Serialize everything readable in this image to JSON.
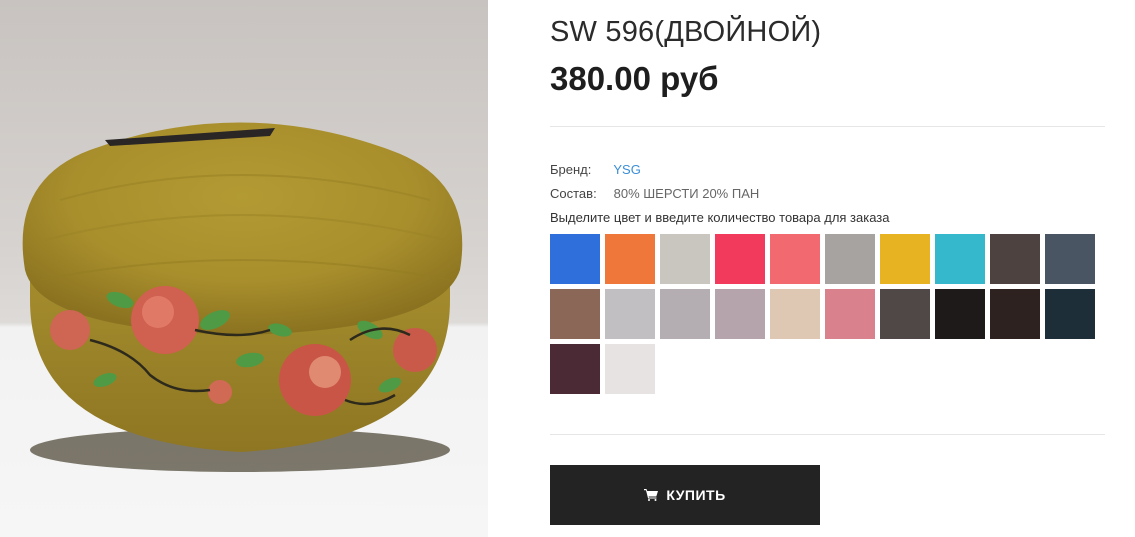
{
  "product": {
    "title": "SW 596(ДВОЙНОЙ)",
    "price": "380.00 руб"
  },
  "meta": {
    "brand_label": "Бренд:",
    "brand_value": "YSG",
    "composition_label": "Состав:",
    "composition_value": "80% ШЕРСТИ 20% ПАН"
  },
  "instruction": "Выделите цвет и введите количество товара для заказа",
  "colors": {
    "swatches": [
      "#2f6fdb",
      "#f0773a",
      "#c9c5bf",
      "#f23a5c",
      "#f26a70",
      "#a6a3a0",
      "#e8b322",
      "#35b8cc",
      "#4e4240",
      "#4a5563",
      "#8a6756",
      "#c2bfc3",
      "#b4aeb2",
      "#b5a4ab",
      "#dfc8b3",
      "#d9828e",
      "#4f4847",
      "#1f1a1a",
      "#2e2220",
      "#1e2e38",
      "#4b2a35",
      "#e8e3e3"
    ],
    "brand_link": "#3a8ed8",
    "button": "#232323"
  },
  "actions": {
    "buy_label": "КУПИТЬ",
    "buy_icon": "cart-icon"
  },
  "image": {
    "icon": "beret-photo"
  }
}
